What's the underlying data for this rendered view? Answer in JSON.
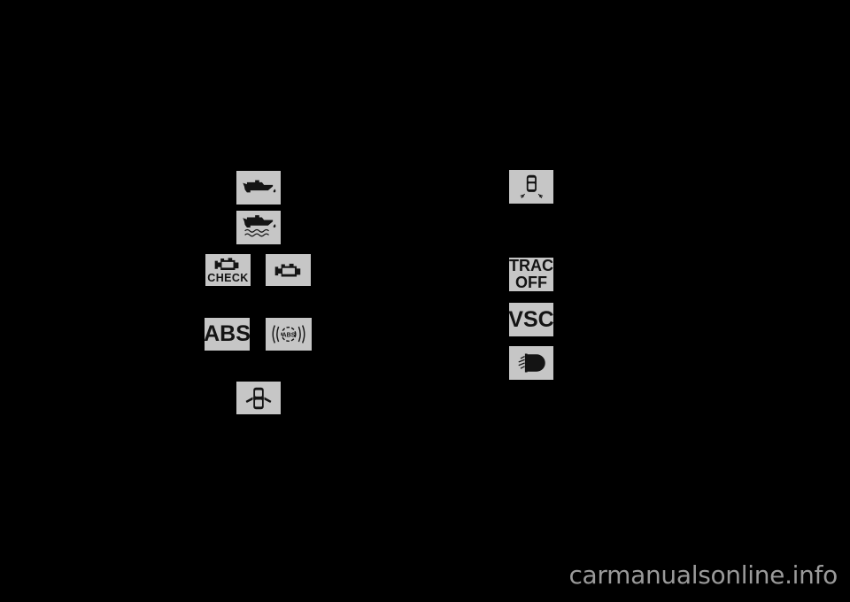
{
  "page": {
    "background_color": "#000000",
    "tile_color": "#c6c6c6",
    "glyph_color": "#141414"
  },
  "indicators": {
    "left_column": [
      {
        "id": "oil-pressure",
        "icon": "oil-can-icon",
        "label": "",
        "description": "Low oil pressure warning light"
      },
      {
        "id": "oil-level",
        "icon": "oil-can-level-icon",
        "label": "",
        "description": "Low engine oil level warning light"
      },
      {
        "id": "check-engine-text",
        "icon": "engine-icon",
        "label": "CHECK",
        "description": "Malfunction indicator lamp with CHECK text"
      },
      {
        "id": "check-engine",
        "icon": "engine-icon",
        "label": "",
        "description": "Malfunction indicator lamp"
      },
      {
        "id": "abs-text",
        "icon": "",
        "label": "ABS",
        "description": "Anti-lock brake system warning light"
      },
      {
        "id": "abs-symbol",
        "icon": "abs-circle-icon",
        "label": "ABS",
        "description": "Anti-lock brake system symbol warning light"
      },
      {
        "id": "door-ajar",
        "icon": "open-door-icon",
        "label": "",
        "description": "Open door warning light"
      }
    ],
    "right_column": [
      {
        "id": "slip-indicator",
        "icon": "skidding-car-icon",
        "label": "",
        "description": "Slip indicator light"
      },
      {
        "id": "trac-off",
        "icon": "",
        "label": "TRAC OFF",
        "label_line1": "TRAC",
        "label_line2": "OFF",
        "description": "Traction control off indicator light"
      },
      {
        "id": "vsc",
        "icon": "",
        "label": "VSC",
        "description": "Vehicle stability control warning light"
      },
      {
        "id": "headlight",
        "icon": "headlight-icon",
        "label": "",
        "description": "Headlight / light failure indicator"
      }
    ]
  },
  "watermark": {
    "text": "carmanualsonline.info"
  }
}
